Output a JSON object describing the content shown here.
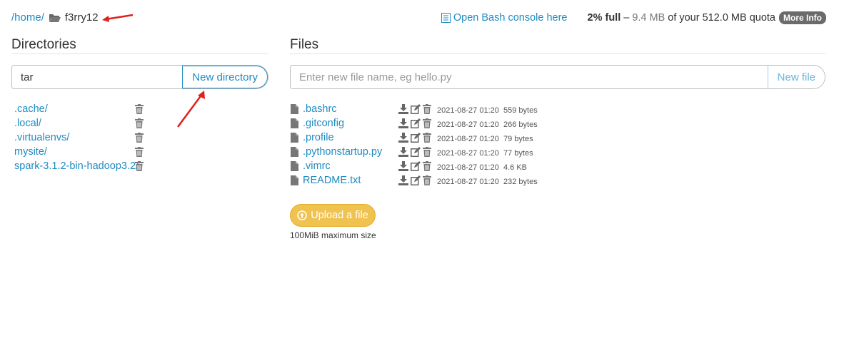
{
  "breadcrumb": {
    "home": "/home/",
    "sep": "/",
    "current": "f3rry12"
  },
  "topbar": {
    "bash_link": "Open Bash console here",
    "quota_pct": "2% full",
    "quota_dash": "–",
    "quota_used": "9.4 MB",
    "quota_rest": "of your 512.0 MB quota",
    "more_info": "More Info"
  },
  "directories": {
    "heading": "Directories",
    "input_value": "tar",
    "input_placeholder": "",
    "new_button": "New directory",
    "items": [
      {
        "name": ".cache/"
      },
      {
        "name": ".local/"
      },
      {
        "name": ".virtualenvs/"
      },
      {
        "name": "mysite/"
      },
      {
        "name": "spark-3.1.2-bin-hadoop3.2/"
      }
    ]
  },
  "files": {
    "heading": "Files",
    "input_value": "",
    "input_placeholder": "Enter new file name, eg hello.py",
    "new_button": "New file",
    "items": [
      {
        "name": ".bashrc",
        "date": "2021-08-27 01:20",
        "size": "559 bytes"
      },
      {
        "name": ".gitconfig",
        "date": "2021-08-27 01:20",
        "size": "266 bytes"
      },
      {
        "name": ".profile",
        "date": "2021-08-27 01:20",
        "size": "79 bytes"
      },
      {
        "name": ".pythonstartup.py",
        "date": "2021-08-27 01:20",
        "size": "77 bytes"
      },
      {
        "name": ".vimrc",
        "date": "2021-08-27 01:20",
        "size": "4.6 KB"
      },
      {
        "name": "README.txt",
        "date": "2021-08-27 01:20",
        "size": "232 bytes"
      }
    ],
    "upload_button": "Upload a file",
    "upload_note": "100MiB maximum size"
  },
  "colors": {
    "link": "#1e8bc3",
    "upload": "#f0c250",
    "annotation": "#e0201c"
  }
}
